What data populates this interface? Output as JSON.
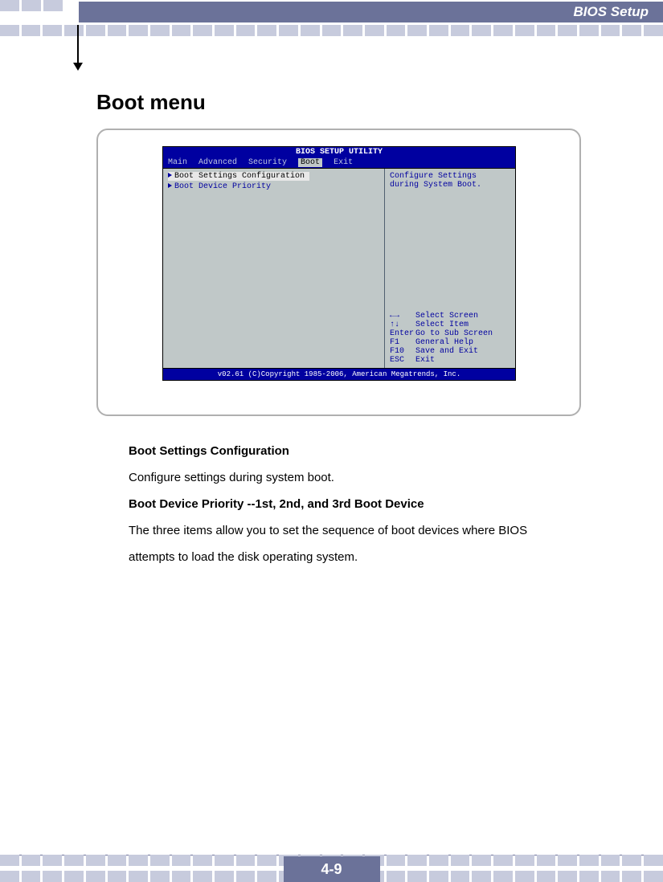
{
  "header": {
    "title": "BIOS Setup"
  },
  "page": {
    "heading": "Boot menu",
    "number": "4-9"
  },
  "bios": {
    "utility_title": "BIOS SETUP UTILITY",
    "tabs": [
      "Main",
      "Advanced",
      "Security",
      "Boot",
      "Exit"
    ],
    "selected_tab": "Boot",
    "left_items": [
      "Boot Settings Configuration",
      "Boot Device Priority"
    ],
    "help": {
      "line1": "Configure Settings",
      "line2": "during System Boot.",
      "keys": [
        {
          "k": "←→",
          "v": "Select Screen"
        },
        {
          "k": "↑↓",
          "v": "Select Item"
        },
        {
          "k": "Enter",
          "v": "Go to Sub Screen"
        },
        {
          "k": "F1",
          "v": "General Help"
        },
        {
          "k": "F10",
          "v": "Save and Exit"
        },
        {
          "k": "ESC",
          "v": "Exit"
        }
      ]
    },
    "footer": "v02.61 (C)Copyright 1985-2006, American Megatrends, Inc."
  },
  "body": {
    "h1": "Boot Settings Configuration",
    "p1": "Configure settings during system boot.",
    "h2": "Boot Device Priority --1st, 2nd, and 3rd Boot Device",
    "p2": "The three items allow you to set the sequence of boot devices where BIOS",
    "p3": "attempts to load the disk operating system."
  }
}
